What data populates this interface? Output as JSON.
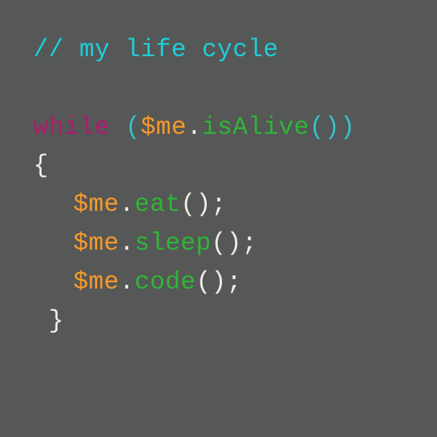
{
  "code": {
    "comment_prefix": "// ",
    "comment_text": "my life cycle",
    "keyword_while": "while",
    "space": " ",
    "paren_open": "(",
    "paren_close": ")",
    "variable": "$me",
    "dot": ".",
    "method_isAlive": "isAlive",
    "method_eat": "eat",
    "method_sleep": "sleep",
    "method_code": "code",
    "brace_open": "{",
    "brace_close": "}",
    "semi": ";"
  }
}
